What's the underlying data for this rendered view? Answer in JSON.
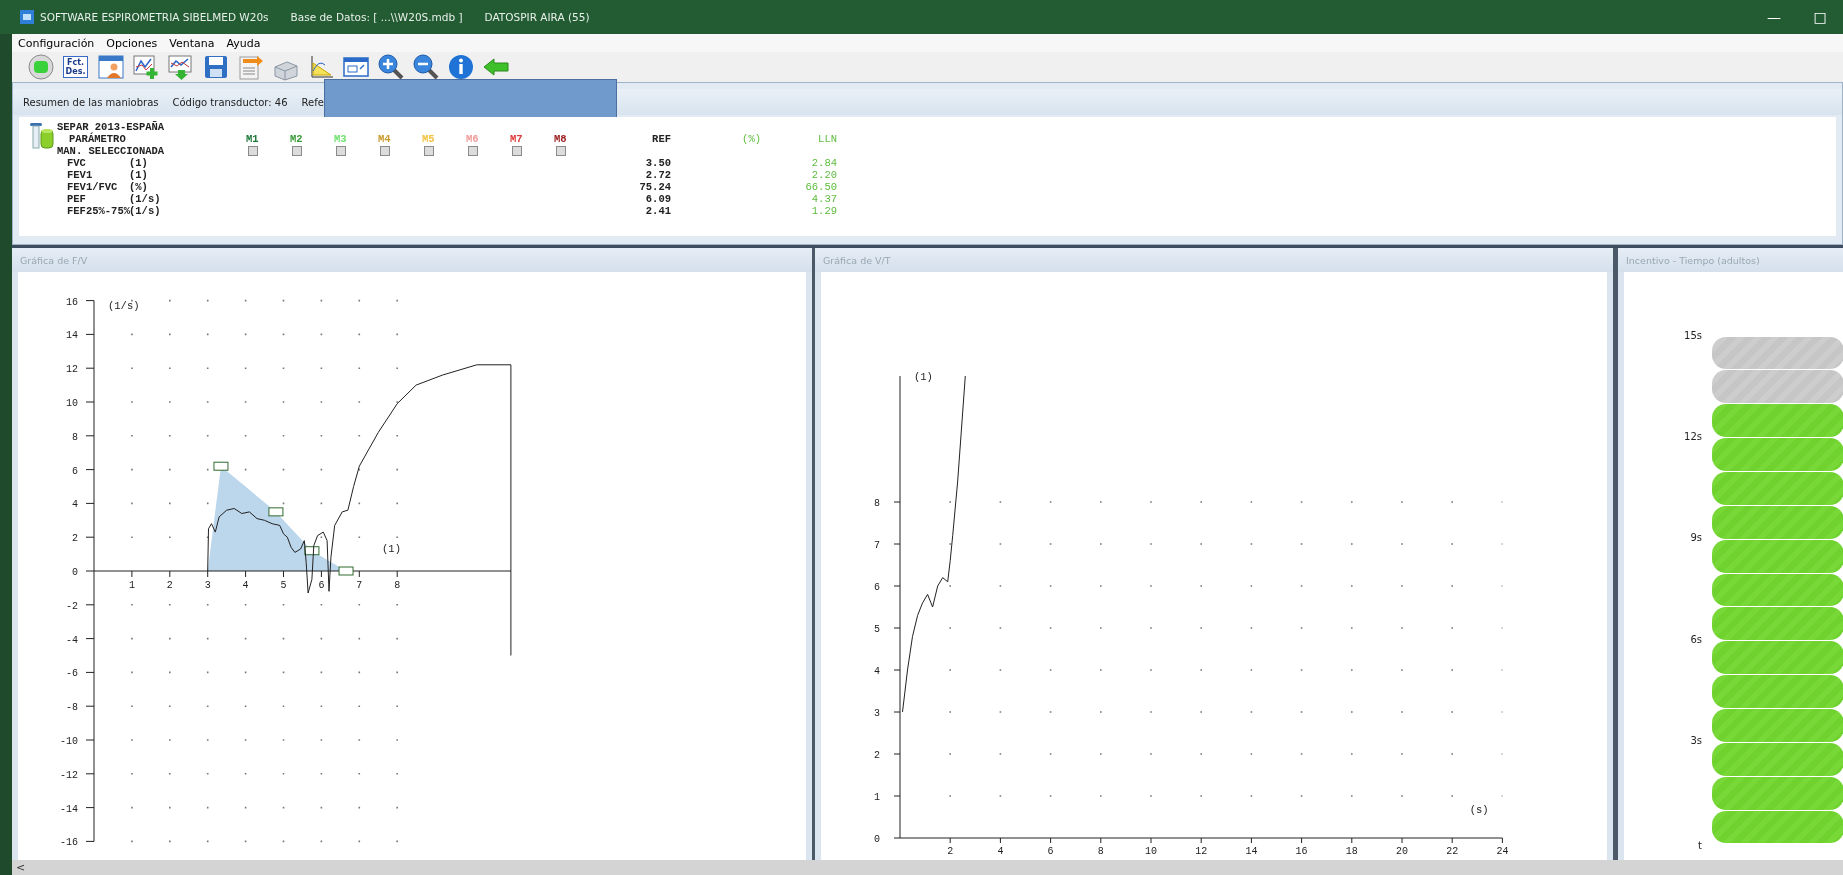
{
  "window": {
    "title": "SOFTWARE ESPIROMETRIA SIBELMED W20s",
    "database": "Base de Datos: [ ...\\\\W20S.mdb ]",
    "patient": "DATOSPIR AIRA (55)",
    "controls": [
      "—",
      "□"
    ]
  },
  "menu": [
    "Configuración",
    "Opciones",
    "Ventana",
    "Ayuda"
  ],
  "toolbar": [
    {
      "kind": "record"
    },
    {
      "kind": "text",
      "lines": [
        "Fct.",
        "Des."
      ]
    },
    {
      "kind": "patient"
    },
    {
      "kind": "add-chart"
    },
    {
      "kind": "import-chart"
    },
    {
      "kind": "save"
    },
    {
      "kind": "report"
    },
    {
      "kind": "box"
    },
    {
      "kind": "axes"
    },
    {
      "kind": "window"
    },
    {
      "kind": "zoom-in"
    },
    {
      "kind": "zoom-out"
    },
    {
      "kind": "info"
    },
    {
      "kind": "back"
    }
  ],
  "summary": {
    "header": [
      "Resumen de las maniobras",
      "Código transductor: 46",
      "Refe"
    ],
    "standard": "SEPAR 2013-ESPAÑA",
    "param_header": "PARÁMETRO",
    "selected_label": "MAN. SELECCIONADA",
    "maneuvers": [
      {
        "label": "M1",
        "color": "#1f7a3c",
        "checked": false
      },
      {
        "label": "M2",
        "color": "#3a9a3a",
        "checked": false
      },
      {
        "label": "M3",
        "color": "#6ee06e",
        "checked": false
      },
      {
        "label": "M4",
        "color": "#c89a2a",
        "checked": false
      },
      {
        "label": "M5",
        "color": "#f2c240",
        "checked": false
      },
      {
        "label": "M6",
        "color": "#f29a9a",
        "checked": false
      },
      {
        "label": "M7",
        "color": "#e03a3a",
        "checked": false
      },
      {
        "label": "M8",
        "color": "#9a1a1a",
        "checked": false
      }
    ],
    "columns": [
      "REF",
      "(%)",
      "LLN"
    ],
    "rows": [
      {
        "name": "FVC",
        "unit": "(1)",
        "ref": "3.50",
        "lln": "2.84"
      },
      {
        "name": "FEV1",
        "unit": "(1)",
        "ref": "2.72",
        "lln": "2.20"
      },
      {
        "name": "FEV1/FVC",
        "unit": "(%)",
        "ref": "75.24",
        "lln": "66.50"
      },
      {
        "name": "PEF",
        "unit": "(1/s)",
        "ref": "6.09",
        "lln": "4.37"
      },
      {
        "name": "FEF25%-75%",
        "unit": "(1/s)",
        "ref": "2.41",
        "lln": "1.29"
      }
    ]
  },
  "panels": {
    "fv": {
      "title": "Gráfica de F/V",
      "chart_data": {
        "type": "line",
        "grid": true,
        "xlabel": "(1)",
        "ylabel": "(1/s)",
        "xlim": [
          0,
          11
        ],
        "ylim": [
          -16,
          16
        ],
        "xticks": [
          1,
          2,
          3,
          4,
          5,
          6,
          7,
          8
        ],
        "yticks": [
          -16,
          -14,
          -12,
          -10,
          -8,
          -6,
          -4,
          -2,
          0,
          2,
          4,
          6,
          8,
          10,
          12,
          14,
          16
        ],
        "series": [
          {
            "type": "area",
            "color": "#bcd6ec",
            "x": [
              3,
              3.35,
              4.8,
              5.75,
              6.65
            ],
            "values": [
              0,
              6.2,
              3.5,
              1.2,
              0
            ]
          },
          {
            "type": "line",
            "color": "#222222",
            "x": [
              3,
              3.02,
              3.1,
              3.2,
              3.3,
              3.5,
              3.7,
              3.9,
              4.1,
              4.3,
              4.5,
              4.7,
              4.9,
              5.0,
              5.1,
              5.2,
              5.3,
              5.45,
              5.55,
              5.6,
              5.65,
              5.75,
              5.8,
              5.9,
              6.05,
              6.15,
              6.2,
              6.25,
              6.35,
              6.55,
              6.7,
              6.85,
              7.0,
              7.5,
              8.0,
              8.5,
              9.2,
              10.1,
              11.0,
              11.0
            ],
            "values": [
              0,
              2.5,
              2.8,
              2.3,
              3.2,
              3.6,
              3.7,
              3.4,
              3.5,
              3.1,
              3.0,
              2.8,
              2.7,
              2.2,
              2.0,
              1.4,
              1.1,
              1.3,
              1.8,
              0.5,
              -1.3,
              -0.5,
              1.5,
              2.1,
              2.3,
              1.8,
              -1.2,
              0.8,
              2.7,
              3.5,
              3.6,
              5.0,
              6.2,
              8.2,
              9.9,
              11.0,
              11.6,
              12.2,
              12.2,
              -5.0
            ]
          }
        ]
      }
    },
    "vt": {
      "title": "Gráfica de V/T",
      "chart_data": {
        "type": "line",
        "grid": true,
        "xlabel": "(s)",
        "ylabel": "(1)",
        "xlim": [
          0,
          24
        ],
        "ylim": [
          0,
          11
        ],
        "xticks": [
          2,
          4,
          6,
          8,
          10,
          12,
          14,
          16,
          18,
          20,
          22,
          24
        ],
        "yticks": [
          0,
          1,
          2,
          3,
          4,
          5,
          6,
          7,
          8
        ],
        "series": [
          {
            "type": "line",
            "color": "#222222",
            "x": [
              0.1,
              0.3,
              0.5,
              0.7,
              0.9,
              1.1,
              1.3,
              1.5,
              1.7,
              1.9,
              2.0,
              2.1,
              2.3,
              2.6
            ],
            "values": [
              3,
              4,
              4.8,
              5.3,
              5.6,
              5.8,
              5.5,
              6,
              6.2,
              6.1,
              6.6,
              7.2,
              8.5,
              11
            ]
          }
        ]
      }
    },
    "incentive": {
      "title": "Incentivo - Tiempo (adultos)",
      "scale": [
        "15s",
        "12s",
        "9s",
        "6s",
        "3s",
        "t"
      ],
      "segments": [
        {
          "on": false
        },
        {
          "on": false
        },
        {
          "on": true
        },
        {
          "on": true
        },
        {
          "on": true
        },
        {
          "on": true
        },
        {
          "on": true
        },
        {
          "on": true
        },
        {
          "on": true
        },
        {
          "on": true
        },
        {
          "on": true
        },
        {
          "on": true
        },
        {
          "on": true
        },
        {
          "on": true
        },
        {
          "on": true
        }
      ]
    }
  },
  "scrollbar": {
    "left_arrow": "<"
  }
}
